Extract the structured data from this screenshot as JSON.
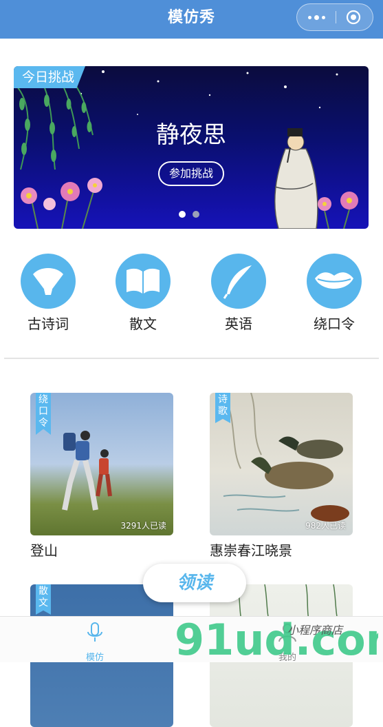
{
  "nav": {
    "title": "模仿秀"
  },
  "banner": {
    "tag": "今日挑战",
    "title": "静夜思",
    "button": "参加挑战",
    "slide_count": 2,
    "active_slide": 1
  },
  "categories": [
    {
      "label": "古诗词",
      "icon": "folding-fan-icon"
    },
    {
      "label": "散文",
      "icon": "open-book-icon"
    },
    {
      "label": "英语",
      "icon": "feather-quill-icon"
    },
    {
      "label": "绕口令",
      "icon": "lips-icon"
    }
  ],
  "cards": [
    {
      "tag": "绕口令",
      "read_count": "3291人已读",
      "name": "登山"
    },
    {
      "tag": "诗歌",
      "read_count": "982人已读",
      "name": "惠崇春江晓景"
    },
    {
      "tag": "散文",
      "read_count": "",
      "name": ""
    },
    {
      "tag": "",
      "read_count": "",
      "name": ""
    }
  ],
  "fab": {
    "label": "领读"
  },
  "tabbar": {
    "items": [
      {
        "label": "模仿",
        "icon": "microphone-icon",
        "active": true
      },
      {
        "label": "我的",
        "icon": "user-icon",
        "active": false
      }
    ]
  },
  "watermark": {
    "text": "91ud.com",
    "subtext": "小程序商店"
  },
  "colors": {
    "nav_bg": "#4f8fd8",
    "accent": "#58b6ec",
    "banner_bg": "#0a0f70"
  }
}
